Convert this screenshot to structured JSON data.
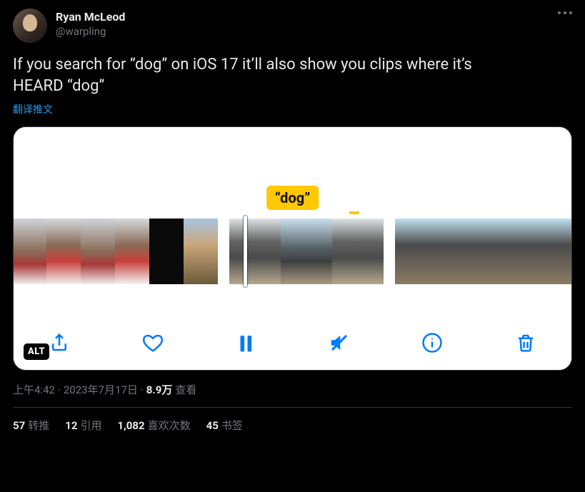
{
  "author": {
    "display_name": "Ryan McLeod",
    "handle": "@warpling"
  },
  "tweet_text_line1": "If you search for “dog” on iOS 17 it’ll also show you clips where it’s",
  "tweet_text_line2": "HEARD “dog”",
  "translate_label": "翻译推文",
  "media": {
    "caption_chip": "“dog”",
    "alt_badge": "ALT",
    "toolbar_icons": {
      "share": "share-icon",
      "like": "heart-icon",
      "pause": "pause-icon",
      "mute": "mute-icon",
      "info": "info-icon",
      "trash": "trash-icon"
    }
  },
  "meta": {
    "time": "上午4:42",
    "dot1": " · ",
    "date": "2023年7月17日",
    "dot2": " · ",
    "views_count": "8.9万",
    "views_label": " 查看"
  },
  "stats": {
    "retweets_count": "57",
    "retweets_label": "转推",
    "quotes_count": "12",
    "quotes_label": "引用",
    "likes_count": "1,082",
    "likes_label": "喜欢次数",
    "bookmarks_count": "45",
    "bookmarks_label": "书签"
  }
}
